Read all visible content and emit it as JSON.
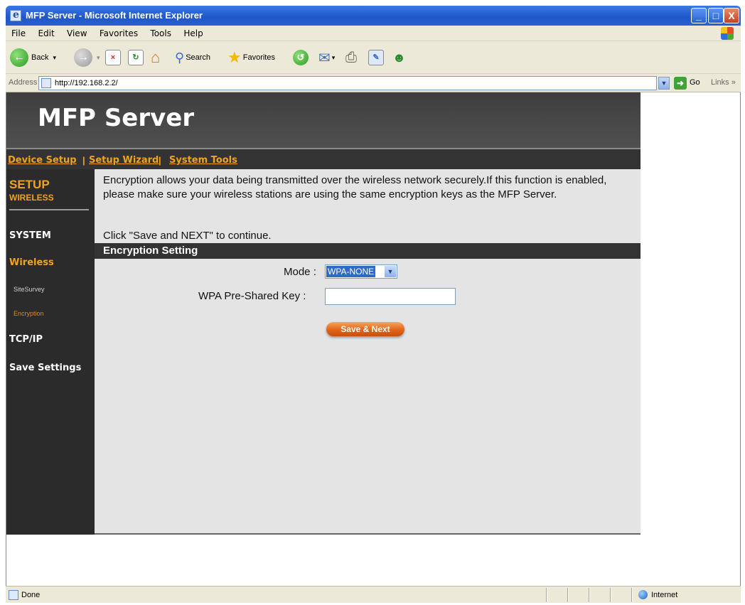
{
  "window": {
    "title": "MFP Server - Microsoft Internet Explorer",
    "minimize": "_",
    "maximize": "□",
    "close": "X"
  },
  "menu": [
    "File",
    "Edit",
    "View",
    "Favorites",
    "Tools",
    "Help"
  ],
  "toolbar": {
    "back": "Back",
    "search": "Search",
    "favorites": "Favorites"
  },
  "address": {
    "label": "Address",
    "url": "http://192.168.2.2/",
    "go": "Go",
    "links": "Links »"
  },
  "page": {
    "brand": "MFP Server",
    "nav": [
      "Device Setup",
      "Setup Wizard",
      "System Tools"
    ],
    "nav_sep": "|",
    "sidebar": {
      "setup": "SETUP",
      "wireless_sub": "WIRELESS",
      "system": "SYSTEM",
      "wireless": "Wireless",
      "site_survey": "SiteSurvey",
      "encryption": "Encryption",
      "tcpip": "TCP/IP",
      "save_settings": "Save Settings"
    },
    "intro": "Encryption allows your data being transmitted over the wireless network securely.If this function is enabled, please make sure your wireless stations are using the same encryption keys as the MFP Server.",
    "click_hint": "Click \"Save and NEXT\" to continue.",
    "section_title": "Encryption Setting",
    "mode_label": "Mode :",
    "mode_value": "WPA-NONE",
    "psk_label": "WPA Pre-Shared Key :",
    "psk_value": "",
    "save_button": "Save & Next"
  },
  "status": {
    "text": "Done",
    "zone": "Internet"
  },
  "colors": {
    "accent": "#f2a21d",
    "header_dark": "#333333",
    "content_bg": "#e4e4e4"
  }
}
